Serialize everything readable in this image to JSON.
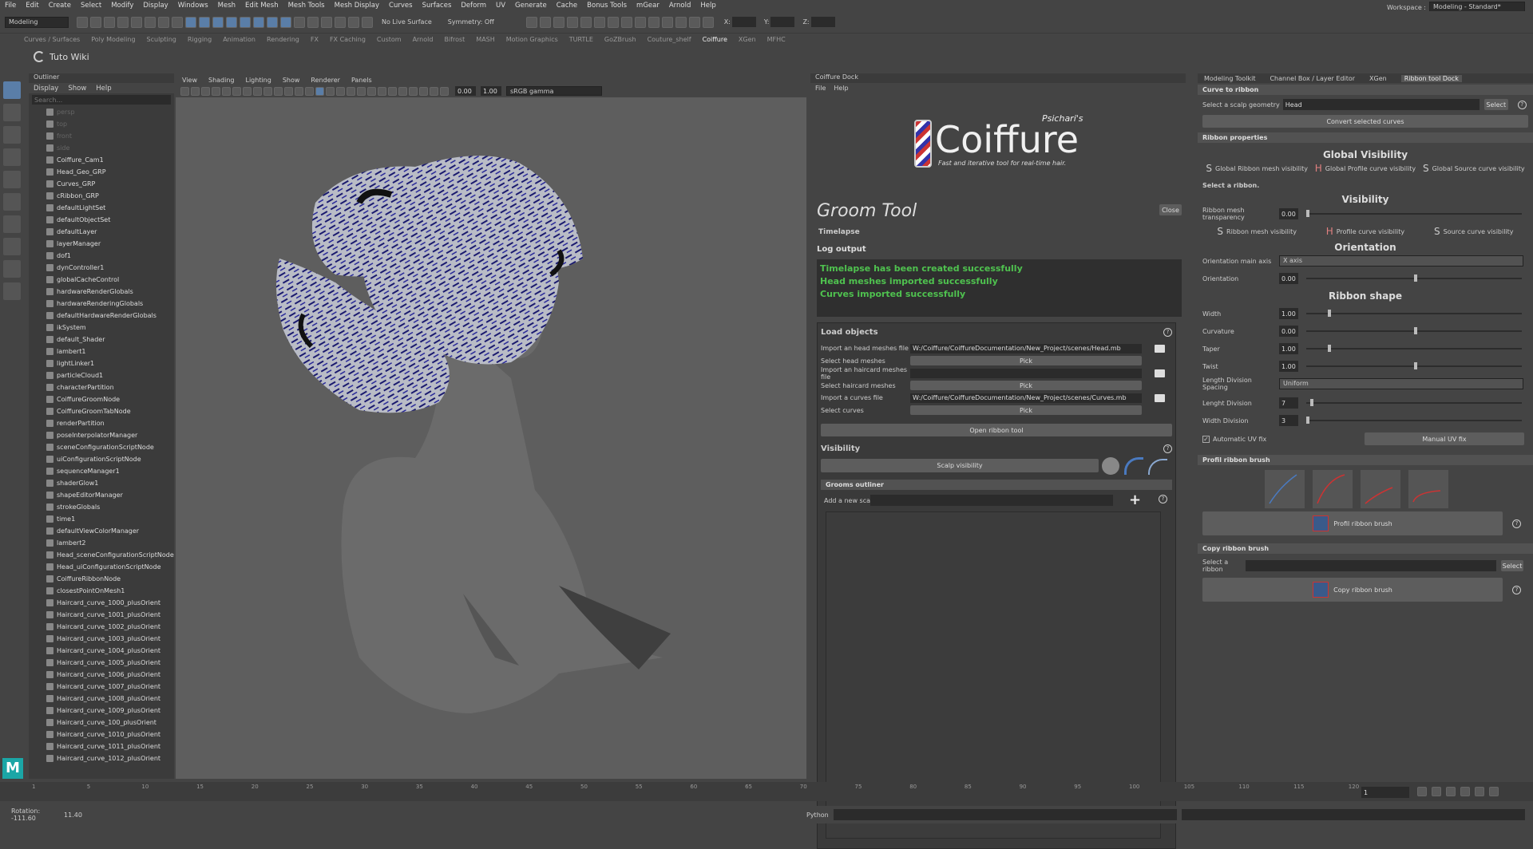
{
  "menu": [
    "File",
    "Edit",
    "Create",
    "Select",
    "Modify",
    "Display",
    "Windows",
    "Mesh",
    "Edit Mesh",
    "Mesh Tools",
    "Mesh Display",
    "Curves",
    "Surfaces",
    "Deform",
    "UV",
    "Generate",
    "Cache",
    "Bonus Tools",
    "mGear",
    "Arnold",
    "Help"
  ],
  "workspace": {
    "label": "Workspace :",
    "value": "Modeling - Standard*"
  },
  "toolbar": {
    "mode": "Modeling",
    "live_surface": "No Live Surface",
    "symmetry": "Symmetry: Off",
    "x": "X:",
    "y": "Y:",
    "z": "Z:"
  },
  "shelf_tabs": [
    "Curves / Surfaces",
    "Poly Modeling",
    "Sculpting",
    "Rigging",
    "Animation",
    "Rendering",
    "FX",
    "FX Caching",
    "Custom",
    "Arnold",
    "Bifrost",
    "MASH",
    "Motion Graphics",
    "TURTLE",
    "GoZBrush",
    "Couture_shelf",
    "Coiffure",
    "XGen",
    "MFHC"
  ],
  "shelf_title": "Tuto Wiki",
  "outliner": {
    "title": "Outliner",
    "menu": [
      "Display",
      "Show",
      "Help"
    ],
    "search_placeholder": "Search...",
    "items": [
      "persp",
      "top",
      "front",
      "side",
      "Coiffure_Cam1",
      "Head_Geo_GRP",
      "Curves_GRP",
      "cRibbon_GRP",
      "defaultLightSet",
      "defaultObjectSet",
      "defaultLayer",
      "layerManager",
      "dof1",
      "dynController1",
      "globalCacheControl",
      "hardwareRenderGlobals",
      "hardwareRenderingGlobals",
      "defaultHardwareRenderGlobals",
      "ikSystem",
      "default_Shader",
      "lambert1",
      "lightLinker1",
      "particleCloud1",
      "characterPartition",
      "CoiffureGroomNode",
      "CoiffureGroomTabNode",
      "renderPartition",
      "poseInterpolatorManager",
      "sceneConfigurationScriptNode",
      "uiConfigurationScriptNode",
      "sequenceManager1",
      "shaderGlow1",
      "shapeEditorManager",
      "strokeGlobals",
      "time1",
      "defaultViewColorManager",
      "lambert2",
      "Head_sceneConfigurationScriptNode",
      "Head_uiConfigurationScriptNode",
      "CoiffureRibbonNode",
      "closestPointOnMesh1",
      "Haircard_curve_1000_plusOrient",
      "Haircard_curve_1001_plusOrient",
      "Haircard_curve_1002_plusOrient",
      "Haircard_curve_1003_plusOrient",
      "Haircard_curve_1004_plusOrient",
      "Haircard_curve_1005_plusOrient",
      "Haircard_curve_1006_plusOrient",
      "Haircard_curve_1007_plusOrient",
      "Haircard_curve_1008_plusOrient",
      "Haircard_curve_1009_plusOrient",
      "Haircard_curve_100_plusOrient",
      "Haircard_curve_1010_plusOrient",
      "Haircard_curve_1011_plusOrient",
      "Haircard_curve_1012_plusOrient"
    ]
  },
  "viewport": {
    "menu": [
      "View",
      "Shading",
      "Lighting",
      "Show",
      "Renderer",
      "Panels"
    ],
    "val1": "0.00",
    "val2": "1.00",
    "colorspace": "sRGB gamma"
  },
  "dock": {
    "title": "Coiffure Dock",
    "menu": [
      "File",
      "Help"
    ],
    "brand_top": "Psichari's",
    "brand": "Coiffure",
    "tagline": "Fast and iterative tool for real-time hair.",
    "groom_title": "Groom Tool",
    "close": "Close",
    "timelapse": "Timelapse",
    "log_title": "Log output",
    "log": [
      "Timelapse has been created successfully",
      "Head meshes imported successfully",
      "Curves imported successfully"
    ],
    "load_title": "Load objects",
    "load_rows": [
      {
        "label": "Import an head meshes file",
        "value": "W:/Coiffure/CoiffureDocumentation/New_Project/scenes/Head.mb",
        "type": "file"
      },
      {
        "label": "Select head meshes",
        "value": "Pick",
        "type": "pick"
      },
      {
        "label": "Import an haircard meshes file",
        "value": "",
        "type": "file"
      },
      {
        "label": "Select haircard meshes",
        "value": "Pick",
        "type": "pick"
      },
      {
        "label": "Import a curves file",
        "value": "W:/Coiffure/CoiffureDocumentation/New_Project/scenes/Curves.mb",
        "type": "file"
      },
      {
        "label": "Select curves",
        "value": "Pick",
        "type": "pick"
      }
    ],
    "open_ribbon": "Open ribbon tool",
    "visibility_title": "Visibility",
    "scalp_visibility": "Scalp visibility",
    "grooms_outliner": "Grooms outliner",
    "add_scalp": "Add a new scalp"
  },
  "rdock": {
    "tabs": [
      "Modeling Toolkit",
      "Channel Box / Layer Editor",
      "XGen",
      "Ribbon tool Dock"
    ],
    "curve_to_ribbon": "Curve to ribbon",
    "select_scalp_label": "Select a scalp geometry",
    "scalp_value": "Head",
    "select": "Select",
    "convert": "Convert selected curves",
    "ribbon_props": "Ribbon properties",
    "global_vis": "Global Visibility",
    "global_btns": [
      "Global Ribbon mesh visibility",
      "Global Profile curve visibility",
      "Global Source curve visibility"
    ],
    "select_ribbon_msg": "Select a ribbon.",
    "visibility": "Visibility",
    "transparency_label": "Ribbon mesh transparency",
    "transparency": "0.00",
    "vis_btns": [
      "Ribbon mesh visibility",
      "Profile curve visibility",
      "Source curve visibility"
    ],
    "orientation": "Orientation",
    "orient_axis_label": "Orientation main axis",
    "orient_axis": "X axis",
    "orientation_label": "Orientation",
    "orientation_val": "0.00",
    "ribbon_shape": "Ribbon shape",
    "shape_rows": [
      {
        "label": "Width",
        "value": "1.00",
        "pos": 0.1
      },
      {
        "label": "Curvature",
        "value": "0.00",
        "pos": 0.5
      },
      {
        "label": "Taper",
        "value": "1.00",
        "pos": 0.1
      },
      {
        "label": "Twist",
        "value": "1.00",
        "pos": 0.5
      }
    ],
    "length_spacing_label": "Length Division Spacing",
    "length_spacing": "Uniform",
    "length_div_label": "Lenght Division",
    "length_div": "7",
    "width_div_label": "Width Division",
    "width_div": "3",
    "auto_uv": "Automatic UV fix",
    "manual_uv": "Manual UV fix",
    "profil_brush_title": "Profil ribbon brush",
    "profil_brush": "Profil ribbon brush",
    "copy_brush_title": "Copy ribbon brush",
    "select_ribbon": "Select a ribbon",
    "copy_brush": "Copy ribbon brush"
  },
  "timeline": {
    "ticks": [
      "1",
      "5",
      "10",
      "15",
      "20",
      "25",
      "30",
      "35",
      "40",
      "45",
      "50",
      "55",
      "60",
      "65",
      "70",
      "75",
      "80",
      "85",
      "90",
      "95",
      "100",
      "105",
      "110",
      "115",
      "120"
    ],
    "frame": "1"
  },
  "status": {
    "rotation": "Rotation: -111.60",
    "val": "11.40",
    "python": "Python"
  }
}
